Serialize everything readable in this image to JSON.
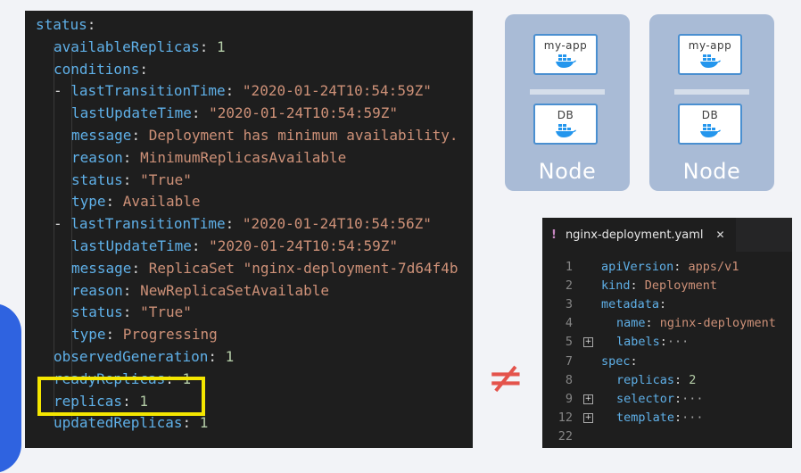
{
  "status_yaml": {
    "lines": [
      {
        "key": "status",
        "sep": ":",
        "val": "",
        "valtype": "p",
        "indent": 0
      },
      {
        "key": "availableReplicas",
        "sep": ": ",
        "val": "1",
        "valtype": "n",
        "indent": 1
      },
      {
        "key": "conditions",
        "sep": ":",
        "val": "",
        "valtype": "p",
        "indent": 1
      },
      {
        "dash": "- ",
        "key": "lastTransitionTime",
        "sep": ": ",
        "val": "\"2020-01-24T10:54:59Z\"",
        "valtype": "s",
        "indent": 1
      },
      {
        "key": "lastUpdateTime",
        "sep": ": ",
        "val": "\"2020-01-24T10:54:59Z\"",
        "valtype": "s",
        "indent": 2
      },
      {
        "key": "message",
        "sep": ": ",
        "val": "Deployment has minimum availability.",
        "valtype": "s",
        "indent": 2
      },
      {
        "key": "reason",
        "sep": ": ",
        "val": "MinimumReplicasAvailable",
        "valtype": "s",
        "indent": 2
      },
      {
        "key": "status",
        "sep": ": ",
        "val": "\"True\"",
        "valtype": "s",
        "indent": 2
      },
      {
        "key": "type",
        "sep": ": ",
        "val": "Available",
        "valtype": "s",
        "indent": 2
      },
      {
        "dash": "- ",
        "key": "lastTransitionTime",
        "sep": ": ",
        "val": "\"2020-01-24T10:54:56Z\"",
        "valtype": "s",
        "indent": 1
      },
      {
        "key": "lastUpdateTime",
        "sep": ": ",
        "val": "\"2020-01-24T10:54:59Z\"",
        "valtype": "s",
        "indent": 2
      },
      {
        "key": "message",
        "sep": ": ",
        "val": "ReplicaSet \"nginx-deployment-7d64f4b",
        "valtype": "s",
        "indent": 2
      },
      {
        "key": "reason",
        "sep": ": ",
        "val": "NewReplicaSetAvailable",
        "valtype": "s",
        "indent": 2
      },
      {
        "key": "status",
        "sep": ": ",
        "val": "\"True\"",
        "valtype": "s",
        "indent": 2
      },
      {
        "key": "type",
        "sep": ": ",
        "val": "Progressing",
        "valtype": "s",
        "indent": 2
      },
      {
        "key": "observedGeneration",
        "sep": ": ",
        "val": "1",
        "valtype": "n",
        "indent": 1
      },
      {
        "key": "readyReplicas",
        "sep": ": ",
        "val": "1",
        "valtype": "n",
        "indent": 1
      },
      {
        "key": "replicas",
        "sep": ": ",
        "val": "1",
        "valtype": "n",
        "indent": 1
      },
      {
        "key": "updatedReplicas",
        "sep": ": ",
        "val": "1",
        "valtype": "n",
        "indent": 1
      }
    ],
    "highlighted_line": "replicas"
  },
  "nodes": [
    {
      "label": "Node",
      "pods": [
        {
          "name": "my-app",
          "icon": "docker-whale-icon"
        },
        {
          "name": "DB",
          "icon": "docker-whale-icon"
        }
      ]
    },
    {
      "label": "Node",
      "pods": [
        {
          "name": "my-app",
          "icon": "docker-whale-icon"
        },
        {
          "name": "DB",
          "icon": "docker-whale-icon"
        }
      ]
    }
  ],
  "not_equal_symbol": "≠",
  "editor": {
    "tab": {
      "icon_glyph": "!",
      "filename": "nginx-deployment.yaml",
      "close_glyph": "✕"
    },
    "lines": [
      {
        "num": "1",
        "fold": false,
        "indent": 0,
        "key": "apiVersion",
        "sep": ": ",
        "val": "apps/v1"
      },
      {
        "num": "2",
        "fold": false,
        "indent": 0,
        "key": "kind",
        "sep": ": ",
        "val": "Deployment"
      },
      {
        "num": "3",
        "fold": false,
        "indent": 0,
        "key": "metadata",
        "sep": ":",
        "val": ""
      },
      {
        "num": "4",
        "fold": false,
        "indent": 1,
        "key": "name",
        "sep": ": ",
        "val": "nginx-deployment"
      },
      {
        "num": "5",
        "fold": true,
        "indent": 1,
        "key": "labels",
        "sep": ":",
        "val": "···"
      },
      {
        "num": "7",
        "fold": false,
        "indent": 0,
        "key": "spec",
        "sep": ":",
        "val": ""
      },
      {
        "num": "8",
        "fold": false,
        "indent": 1,
        "key": "replicas",
        "sep": ": ",
        "val": "2"
      },
      {
        "num": "9",
        "fold": true,
        "indent": 1,
        "key": "selector",
        "sep": ":",
        "val": "···"
      },
      {
        "num": "12",
        "fold": true,
        "indent": 1,
        "key": "template",
        "sep": ":",
        "val": "···"
      },
      {
        "num": "22",
        "fold": false,
        "indent": 0,
        "key": "",
        "sep": "",
        "val": ""
      }
    ]
  },
  "colors": {
    "highlight": "#f4e600",
    "not_equal": "#e4534c",
    "node_bg": "#a9bbd6",
    "pod_border": "#4a8fd0"
  }
}
